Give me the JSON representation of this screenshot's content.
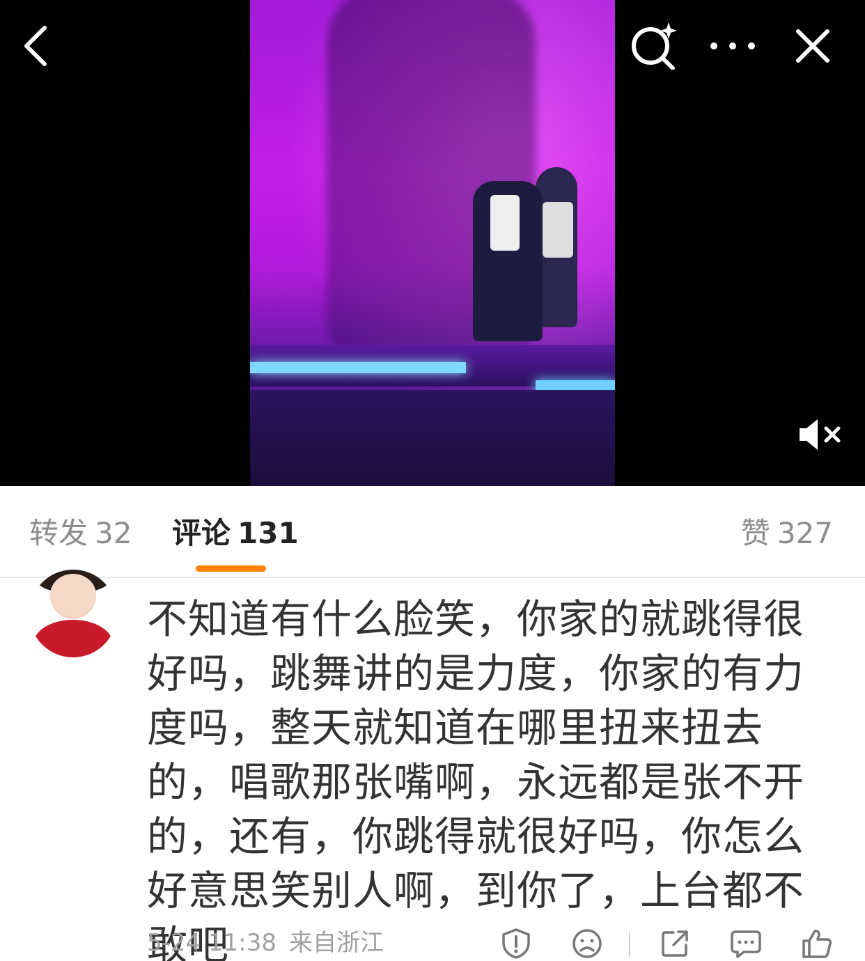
{
  "tabs": {
    "repost": {
      "label": "转发",
      "count": "32"
    },
    "comment": {
      "label": "评论",
      "count": "131"
    },
    "like": {
      "label": "赞",
      "count": "327"
    }
  },
  "comment": {
    "text": "不知道有什么脸笑，你家的就跳得很好吗，跳舞讲的是力度，你家的有力度吗，整天就知道在哪里扭来扭去的，唱歌那张嘴啊，永远都是张不开的，还有，你跳得就很好吗，你怎么好意思笑别人啊，到你了，上台都不敢吧",
    "time": "5-24 11:38",
    "location": "来自浙江"
  },
  "icons": [
    "back-icon",
    "search-sparkle-icon",
    "more-icon",
    "close-icon",
    "mute-icon",
    "report-icon",
    "dislike-icon",
    "share-icon",
    "reply-icon",
    "thumbs-up-icon"
  ],
  "colors": {
    "accent": "#ff8200",
    "video_bg": "#000000"
  }
}
